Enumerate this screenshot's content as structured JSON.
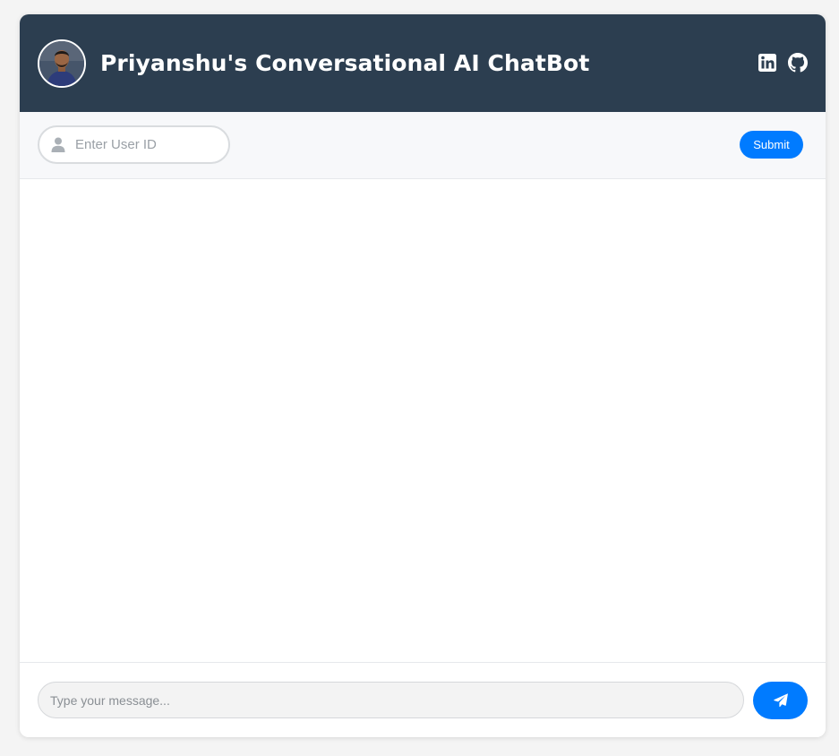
{
  "header": {
    "title": "Priyanshu's Conversational AI ChatBot",
    "avatar_icon": "profile-photo",
    "social": [
      "linkedin-icon",
      "github-icon"
    ]
  },
  "user_bar": {
    "placeholder": "Enter User ID",
    "value": "",
    "icon": "user-icon",
    "submit_label": "Submit"
  },
  "composer": {
    "placeholder": "Type your message...",
    "value": "",
    "send_icon": "paper-plane-icon"
  },
  "colors": {
    "header_bg": "#2c3e50",
    "accent": "#007bff",
    "page_bg": "#f4f4f4"
  }
}
